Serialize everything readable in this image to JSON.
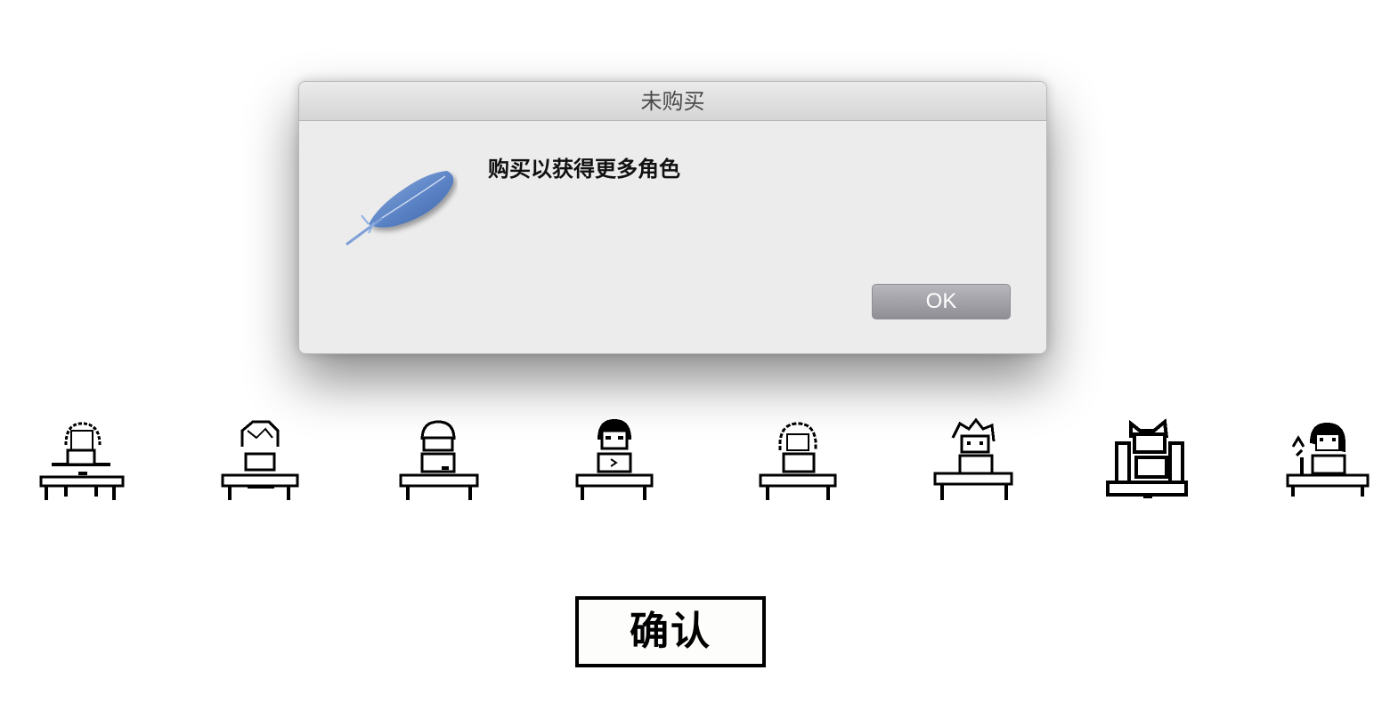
{
  "characters": [
    {
      "name": "character-1"
    },
    {
      "name": "character-2"
    },
    {
      "name": "character-3"
    },
    {
      "name": "character-4"
    },
    {
      "name": "character-5"
    },
    {
      "name": "character-6"
    },
    {
      "name": "character-7"
    },
    {
      "name": "character-8"
    }
  ],
  "confirm": {
    "label": "确认"
  },
  "dialog": {
    "title": "未购买",
    "icon": "feather-icon",
    "message": "购买以获得更多角色",
    "ok_label": "OK"
  },
  "colors": {
    "dialog_bg": "#ececec",
    "ok_button": "#a3a2a8",
    "feather": "#5a82c4"
  }
}
